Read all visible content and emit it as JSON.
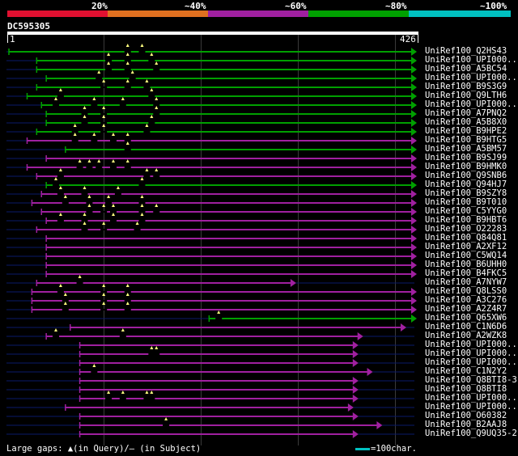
{
  "scale": {
    "labels": [
      "20%",
      "~40%",
      "~60%",
      "~80%",
      "~100%"
    ],
    "colors": [
      "#e01030",
      "#e07020",
      "#a020a0",
      "#00a000",
      "#00c0c0"
    ]
  },
  "query": {
    "name": "DC595305",
    "start": "1",
    "end": "426",
    "length": 426
  },
  "hits": [
    {
      "name": "UniRef100_Q2HS43",
      "color": "green",
      "start": 1,
      "end": 426,
      "gaps": [
        125,
        140
      ]
    },
    {
      "name": "UniRef100_UPI000..",
      "color": "green",
      "start": 30,
      "end": 426,
      "gaps": [
        105,
        125,
        150
      ]
    },
    {
      "name": "UniRef100_A5BC54",
      "color": "green",
      "start": 30,
      "end": 426,
      "gaps": [
        105,
        125,
        155
      ]
    },
    {
      "name": "UniRef100_UPI000..",
      "color": "green",
      "start": 40,
      "end": 426,
      "gaps": [
        95,
        130
      ]
    },
    {
      "name": "UniRef100_B9S3G9",
      "color": "green",
      "start": 30,
      "end": 426,
      "gaps": [
        100,
        125,
        145
      ]
    },
    {
      "name": "UniRef100_Q9LTH6",
      "color": "green",
      "start": 20,
      "end": 426,
      "gaps": [
        55,
        150
      ]
    },
    {
      "name": "UniRef100_UPI000..",
      "color": "green",
      "start": 35,
      "end": 426,
      "gaps": [
        50,
        90,
        120,
        155
      ]
    },
    {
      "name": "UniRef100_A7PNQ2",
      "color": "green",
      "start": 40,
      "end": 426,
      "gaps": [
        80,
        100,
        155
      ]
    },
    {
      "name": "UniRef100_A5B8X0",
      "color": "green",
      "start": 40,
      "end": 426,
      "gaps": [
        80,
        100,
        150
      ]
    },
    {
      "name": "UniRef100_B9HPE2",
      "color": "green",
      "start": 30,
      "end": 426,
      "gaps": [
        70,
        100,
        145
      ]
    },
    {
      "name": "UniRef100_B9HTG5",
      "color": "purple",
      "start": 20,
      "end": 426,
      "gaps": [
        70,
        90,
        110,
        125
      ]
    },
    {
      "name": "UniRef100_A5BM57",
      "color": "green",
      "start": 60,
      "end": 426,
      "gaps": [
        125
      ]
    },
    {
      "name": "UniRef100_B9SJ99",
      "color": "purple",
      "start": 40,
      "end": 426,
      "gaps": []
    },
    {
      "name": "UniRef100_B9HMK0",
      "color": "purple",
      "start": 20,
      "end": 426,
      "gaps": [
        75,
        85,
        95,
        110,
        125
      ]
    },
    {
      "name": "UniRef100_Q9SNB6",
      "color": "purple",
      "start": 30,
      "end": 426,
      "gaps": [
        55,
        145,
        155
      ]
    },
    {
      "name": "UniRef100_Q94HJ7",
      "color": "green",
      "start": 40,
      "end": 426,
      "gaps": [
        50,
        140
      ]
    },
    {
      "name": "UniRef100_B9SZY8",
      "color": "purple",
      "start": 35,
      "end": 426,
      "gaps": [
        55,
        80,
        115
      ]
    },
    {
      "name": "UniRef100_B9T010",
      "color": "purple",
      "start": 25,
      "end": 426,
      "gaps": [
        60,
        85,
        105,
        140
      ]
    },
    {
      "name": "UniRef100_C5YYG0",
      "color": "purple",
      "start": 35,
      "end": 426,
      "gaps": [
        85,
        100,
        110,
        140,
        155
      ]
    },
    {
      "name": "UniRef100_B9HBT6",
      "color": "purple",
      "start": 40,
      "end": 426,
      "gaps": [
        55,
        80,
        110,
        140
      ]
    },
    {
      "name": "UniRef100_O22283",
      "color": "purple",
      "start": 30,
      "end": 426,
      "gaps": [
        80,
        100,
        135
      ]
    },
    {
      "name": "UniRef100_Q84Q81",
      "color": "purple",
      "start": 40,
      "end": 426,
      "gaps": []
    },
    {
      "name": "UniRef100_A2XF12",
      "color": "purple",
      "start": 40,
      "end": 426,
      "gaps": []
    },
    {
      "name": "UniRef100_C5WQ14",
      "color": "purple",
      "start": 40,
      "end": 426,
      "gaps": []
    },
    {
      "name": "UniRef100_B6UHH0",
      "color": "purple",
      "start": 40,
      "end": 426,
      "gaps": []
    },
    {
      "name": "UniRef100_B4FKC5",
      "color": "purple",
      "start": 40,
      "end": 426,
      "gaps": []
    },
    {
      "name": "UniRef100_A7NYW7",
      "color": "purple",
      "start": 30,
      "end": 300,
      "gaps": [
        75
      ]
    },
    {
      "name": "UniRef100_Q8LSS0",
      "color": "purple",
      "start": 25,
      "end": 426,
      "gaps": [
        55,
        100,
        125
      ]
    },
    {
      "name": "UniRef100_A3C276",
      "color": "purple",
      "start": 25,
      "end": 426,
      "gaps": [
        60,
        100,
        125
      ]
    },
    {
      "name": "UniRef100_A2Z4R7",
      "color": "purple",
      "start": 25,
      "end": 426,
      "gaps": [
        60,
        100,
        125
      ]
    },
    {
      "name": "UniRef100_Q65XW6",
      "color": "green",
      "start": 210,
      "end": 426,
      "gaps": [
        220
      ]
    },
    {
      "name": "UniRef100_C1N6D6",
      "color": "purple",
      "start": 65,
      "end": 415,
      "gaps": []
    },
    {
      "name": "UniRef100_A2WZK8",
      "color": "purple",
      "start": 40,
      "end": 370,
      "gaps": [
        50,
        120
      ]
    },
    {
      "name": "UniRef100_UPI000..",
      "color": "purple",
      "start": 75,
      "end": 365,
      "gaps": []
    },
    {
      "name": "UniRef100_UPI000..",
      "color": "purple",
      "start": 75,
      "end": 365,
      "gaps": [
        150,
        155
      ]
    },
    {
      "name": "UniRef100_UPI000..",
      "color": "purple",
      "start": 75,
      "end": 365,
      "gaps": []
    },
    {
      "name": "UniRef100_C1N2Y2",
      "color": "purple",
      "start": 75,
      "end": 380,
      "gaps": [
        90
      ]
    },
    {
      "name": "UniRef100_Q8BTI8-3",
      "color": "purple",
      "start": 75,
      "end": 365,
      "gaps": []
    },
    {
      "name": "UniRef100_Q8BTI8",
      "color": "purple",
      "start": 75,
      "end": 365,
      "gaps": []
    },
    {
      "name": "UniRef100_UPI000..",
      "color": "purple",
      "start": 75,
      "end": 365,
      "gaps": [
        105,
        120,
        145,
        150
      ]
    },
    {
      "name": "UniRef100_UPI000..",
      "color": "purple",
      "start": 60,
      "end": 360,
      "gaps": []
    },
    {
      "name": "UniRef100_O60382",
      "color": "purple",
      "start": 75,
      "end": 365,
      "gaps": []
    },
    {
      "name": "UniRef100_B2AAJ8",
      "color": "purple",
      "start": 75,
      "end": 390,
      "gaps": [
        165
      ]
    },
    {
      "name": "UniRef100_Q9UQ35-2",
      "color": "purple",
      "start": 75,
      "end": 365,
      "gaps": []
    }
  ],
  "colors": {
    "green": "#00a000",
    "purple": "#a020a0",
    "unaligned": "#0a1a6a"
  },
  "footer": {
    "gaps_text": "Large gaps: ▲(in Query)/– (in Subject)",
    "legend_text": "=100char."
  }
}
